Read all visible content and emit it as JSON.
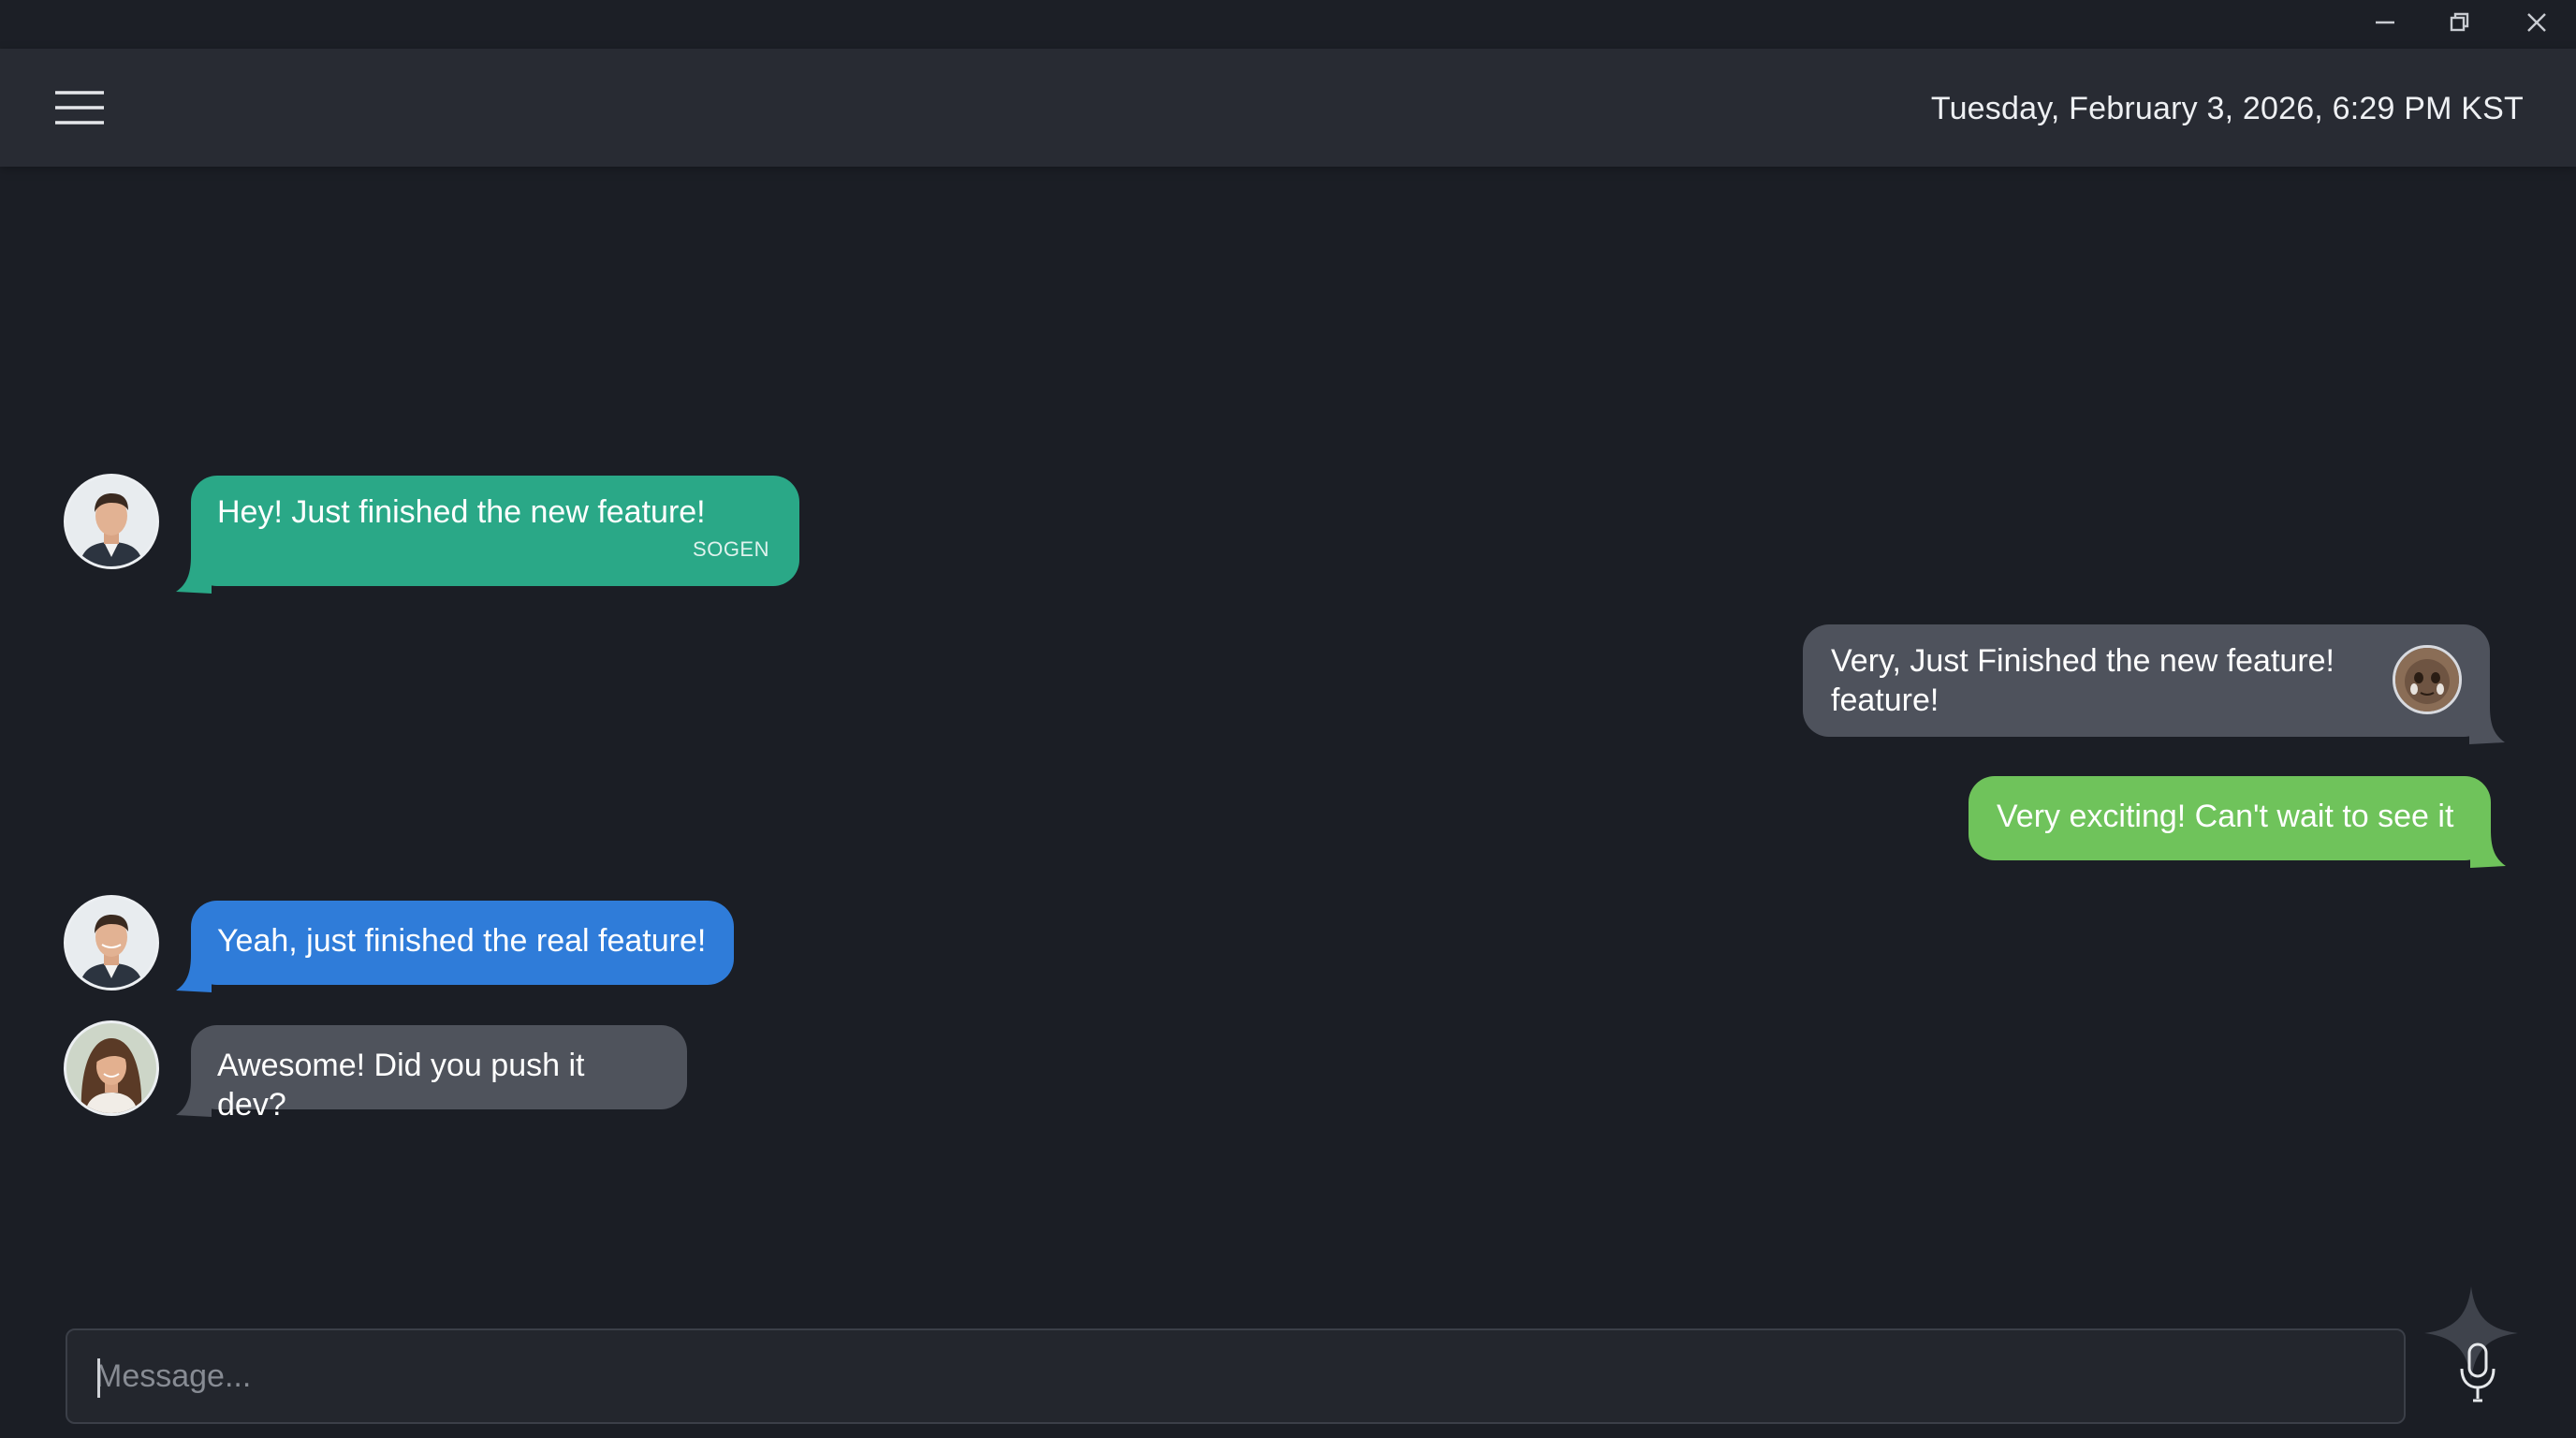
{
  "titlebar": {
    "minimize_icon": "minimize-icon",
    "restore_icon": "restore-icon",
    "close_icon": "close-icon"
  },
  "header": {
    "menu_icon": "hamburger-menu-icon",
    "datetime": "Tuesday, February 3, 2026, 6:29 PM KST"
  },
  "messages": [
    {
      "side": "left",
      "text": "Hey! Just finished the new feature!",
      "sender": "SOGEN",
      "color": "#2aa887",
      "avatar": "man-avatar"
    },
    {
      "side": "right",
      "text_line1": "Very, Just Finished the new feature!",
      "text_line2": "feature!",
      "color": "#4e525c",
      "avatar": "emoji-avatar"
    },
    {
      "side": "right",
      "text": "Very exciting! Can't wait to see it",
      "color": "#6fc35b"
    },
    {
      "side": "left",
      "text": "Yeah, just finished the real feature!",
      "color": "#2f7cd9",
      "avatar": "man-avatar"
    },
    {
      "side": "left",
      "text": "Awesome! Did you push it dev?",
      "color": "#4f535c",
      "avatar": "woman-avatar"
    }
  ],
  "composer": {
    "placeholder": "Message...",
    "value": "",
    "sparkle_icon": "sparkle-icon",
    "mic_icon": "microphone-icon"
  },
  "theme": {
    "background": "#1b1e25",
    "header": "#282b33"
  }
}
